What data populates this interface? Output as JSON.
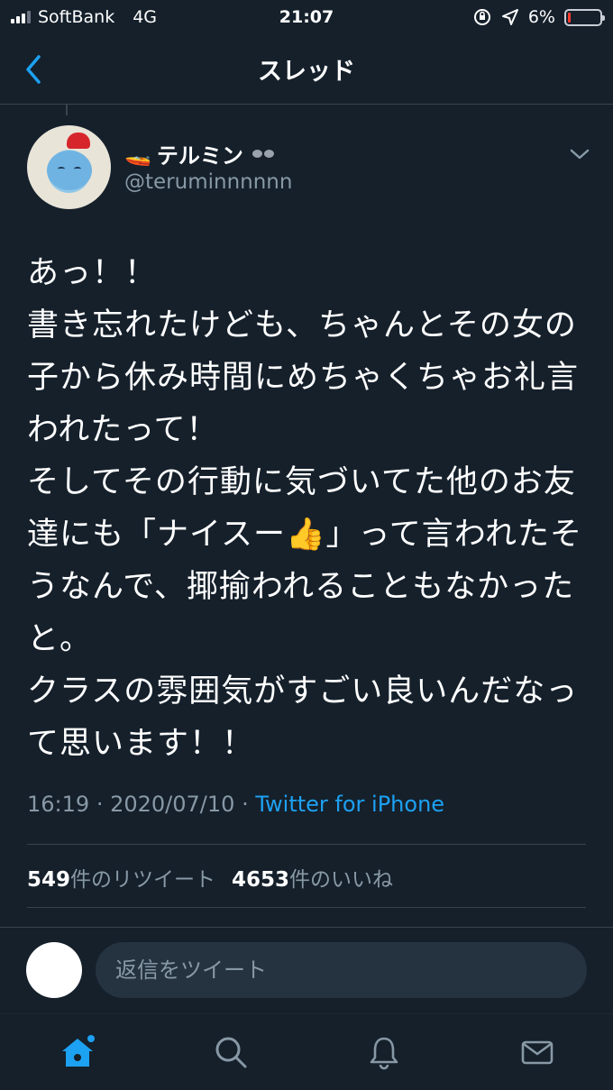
{
  "status_bar": {
    "carrier": "SoftBank",
    "network": "4G",
    "time": "21:07",
    "battery": "6%",
    "battery_level": 0.06,
    "colors": {
      "battery_low": "#ff3b30"
    }
  },
  "header": {
    "title": "スレッド",
    "back_icon": "chevron-left-icon"
  },
  "tweet": {
    "display_name": "テルミン",
    "name_emoji": [
      "boat-emoji",
      "glasses-emoji"
    ],
    "handle": "@teruminnnnnn",
    "text": "あっ！！\n書き忘れたけども、ちゃんとその女の子から休み時間にめちゃくちゃお礼言われたって！\nそしてその行動に気づいてた他のお友達にも「ナイスー👍」って言われたそうなんで、揶揄われることもなかったと。\nクラスの雰囲気がすごい良いんだなって思います！！",
    "time": "16:19",
    "date": "2020/07/10",
    "separator": "·",
    "client": "Twitter for iPhone",
    "retweets": "549",
    "retweets_label": "件のリツイート",
    "likes": "4653",
    "likes_label": "件のいいね"
  },
  "reply": {
    "placeholder": "返信をツイート"
  },
  "tabs": [
    {
      "name": "home",
      "icon": "home-icon",
      "active": true
    },
    {
      "name": "search",
      "icon": "search-icon"
    },
    {
      "name": "notifications",
      "icon": "bell-icon"
    },
    {
      "name": "messages",
      "icon": "mail-icon"
    }
  ],
  "colors": {
    "background": "#15202b",
    "accent": "#1da1f2",
    "secondary_text": "#8899a6",
    "border": "#38444d"
  }
}
